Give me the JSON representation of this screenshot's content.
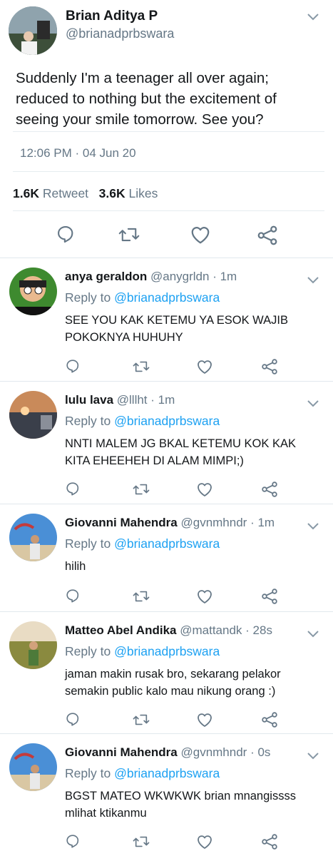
{
  "main": {
    "name": "Brian Aditya P",
    "handle": "@brianadprbswara",
    "text": "Suddenly I'm a teenager all over again; reduced to nothing but the excitement of seeing your smile tomorrow. See you?",
    "time": "12:06 PM",
    "date": "04 Jun 20",
    "retweets_count": "1.6K",
    "retweets_label": "Retweet",
    "likes_count": "3.6K",
    "likes_label": "Likes"
  },
  "reply_to_label": "Reply to",
  "replies": [
    {
      "name": "anya geraldon",
      "handle": "@anygrldn",
      "time": "1m",
      "mention": "@brianadprbswara",
      "text": "SEE YOU KAK KETEMU YA ESOK WAJIB POKOKNYA HUHUHY"
    },
    {
      "name": "lulu lava",
      "handle": "@lllht",
      "time": "1m",
      "mention": "@brianadprbswara",
      "text": "NNTI MALEM JG BKAL KETEMU KOK KAK KITA EHEEHEH DI ALAM MIMPI;)"
    },
    {
      "name": "Giovanni Mahendra",
      "handle": "@gvnmhndr",
      "time": "1m",
      "mention": "@brianadprbswara",
      "text": "hilih"
    },
    {
      "name": "Matteo Abel Andika",
      "handle": "@mattandk",
      "time": "28s",
      "mention": "@brianadprbswara",
      "text": "jaman makin rusak bro, sekarang pelakor semakin public kalo mau nikung orang :)"
    },
    {
      "name": "Giovanni Mahendra",
      "handle": "@gvnmhndr",
      "time": "0s",
      "mention": "@brianadprbswara",
      "text": "BGST MATEO WKWKWK brian mnangissss mlihat ktikanmu"
    }
  ],
  "colors": {
    "accent": "#1da1f2",
    "secondary_text": "#657786",
    "icon": "#657786"
  },
  "icons": [
    "reply-icon",
    "retweet-icon",
    "like-icon",
    "share-icon",
    "chevron-down-icon"
  ]
}
